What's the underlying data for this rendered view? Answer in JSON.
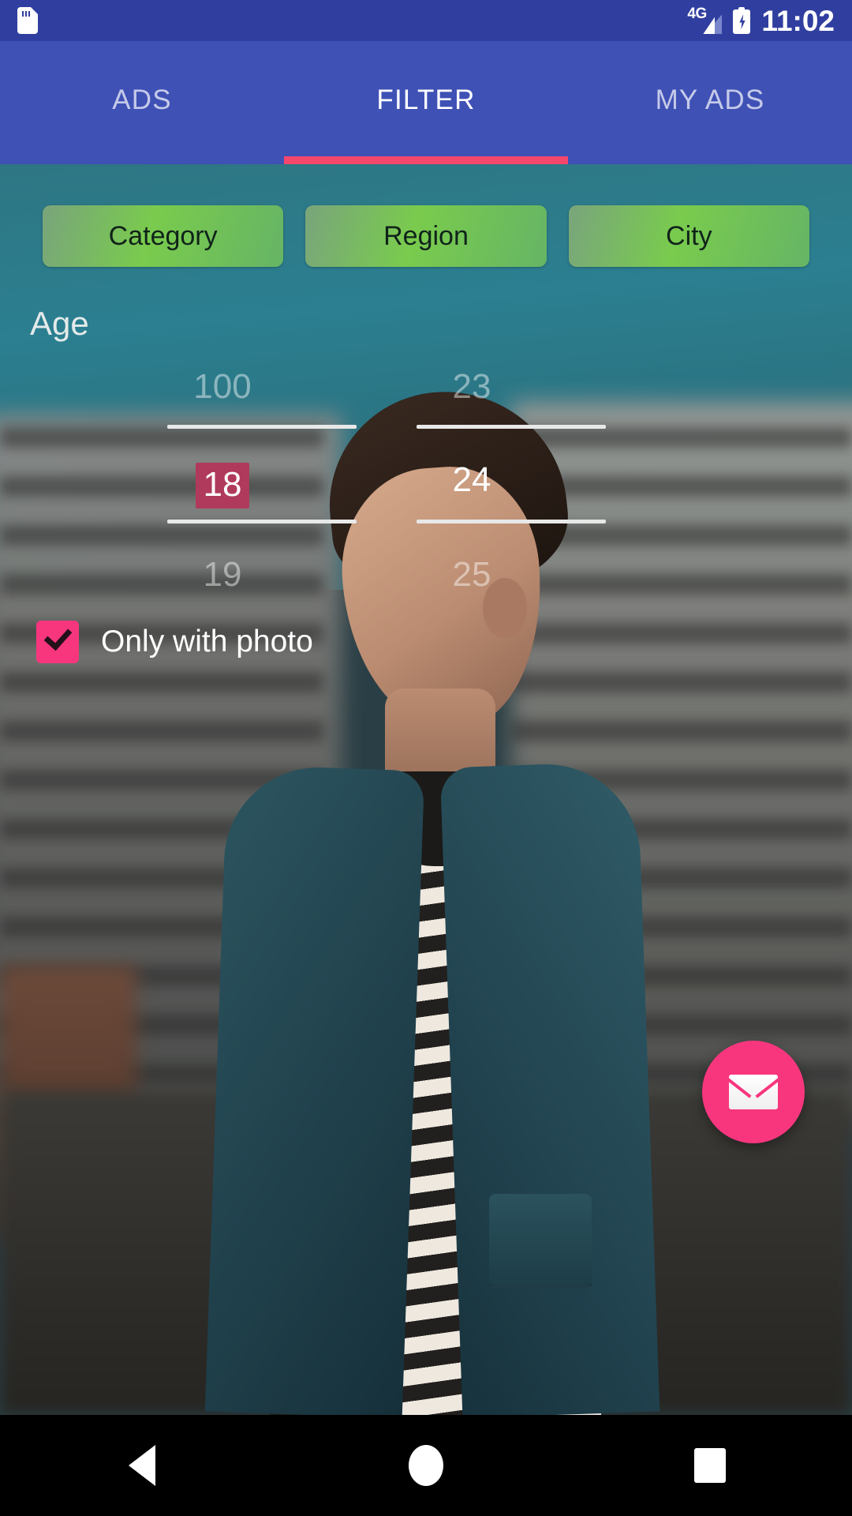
{
  "status_bar": {
    "sim_icon": "sim-card-icon",
    "network_label": "4G",
    "signal_icon": "signal-bars-icon",
    "battery_icon": "battery-charging-icon",
    "time": "11:02"
  },
  "tabs": {
    "items": [
      {
        "label": "ADS",
        "active": false
      },
      {
        "label": "FILTER",
        "active": true
      },
      {
        "label": "MY ADS",
        "active": false
      }
    ],
    "indicator_color": "#f4476b",
    "bar_color": "#3f51b5"
  },
  "filter": {
    "chips": [
      {
        "label": "Category"
      },
      {
        "label": "Region"
      },
      {
        "label": "City"
      }
    ],
    "age_label": "Age",
    "age_from": {
      "previous": "100",
      "current": "18",
      "next": "19",
      "highlight_color": "#b03a5b"
    },
    "age_to": {
      "previous": "23",
      "current": "24",
      "next": "25"
    },
    "only_with_photo": {
      "label": "Only with photo",
      "checked": true,
      "color": "#f8367e"
    },
    "fab": {
      "icon": "envelope-icon",
      "color": "#f8367e"
    }
  },
  "nav_bar": {
    "back": "back-triangle-icon",
    "home": "home-circle-icon",
    "recents": "recents-square-icon"
  }
}
